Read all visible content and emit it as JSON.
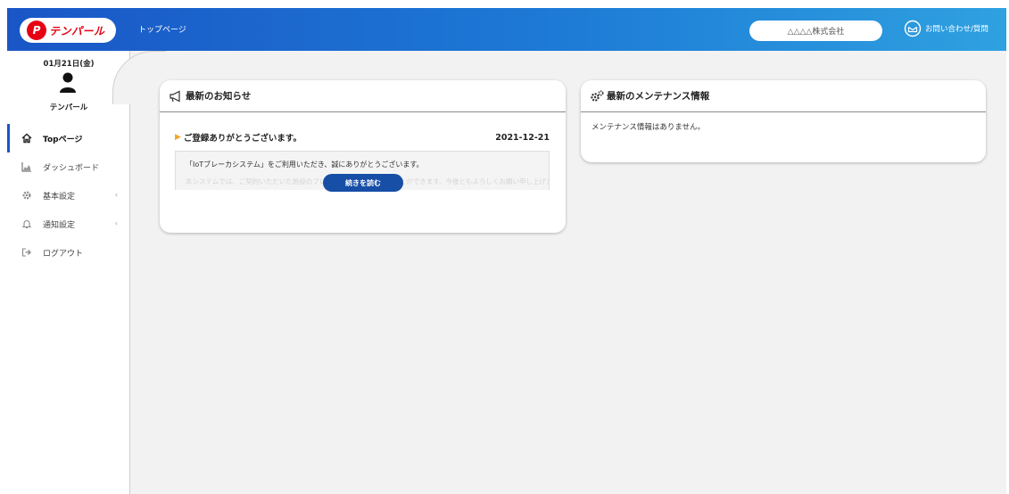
{
  "header": {
    "logo_text": "テンパール",
    "logo_mark": "P",
    "page_title": "トップページ",
    "company_name": "△△△△株式会社",
    "contact_label": "お問い合わせ/質問",
    "contact_icon": "mail-icon"
  },
  "sidebar": {
    "date": "01月21日(金)",
    "user_name": "テンパール",
    "items": [
      {
        "label": "Topページ",
        "icon": "home-icon",
        "active": true
      },
      {
        "label": "ダッシュボード",
        "icon": "area-chart-icon"
      },
      {
        "label": "基本設定",
        "icon": "gear-icon",
        "chevron": "‹"
      },
      {
        "label": "通知設定",
        "icon": "bell-icon",
        "chevron": "‹"
      },
      {
        "label": "ログアウト",
        "icon": "logout-icon"
      }
    ]
  },
  "news": {
    "title": "最新のお知らせ",
    "item_title": "ご登録ありがとうございます。",
    "item_date": "2021-12-21",
    "item_body": "「IoTブレーカシステム」をご利用いただき、誠にありがとうございます。",
    "item_body_more": "本システムでは、ご契約いただいた施設のブレーカの状態を確認することができます。今後ともよろしくお願い申し上げます。",
    "read_more_label": "続きを読む"
  },
  "maintenance": {
    "title": "最新のメンテナンス情報",
    "empty_text": "メンテナンス情報はありません。"
  },
  "colors": {
    "header_gradient_start": "#1a56c6",
    "header_gradient_end": "#2fa1e0",
    "brand_red": "#e60012",
    "button_blue": "#174ea6",
    "accent_orange": "#f2a42c"
  }
}
